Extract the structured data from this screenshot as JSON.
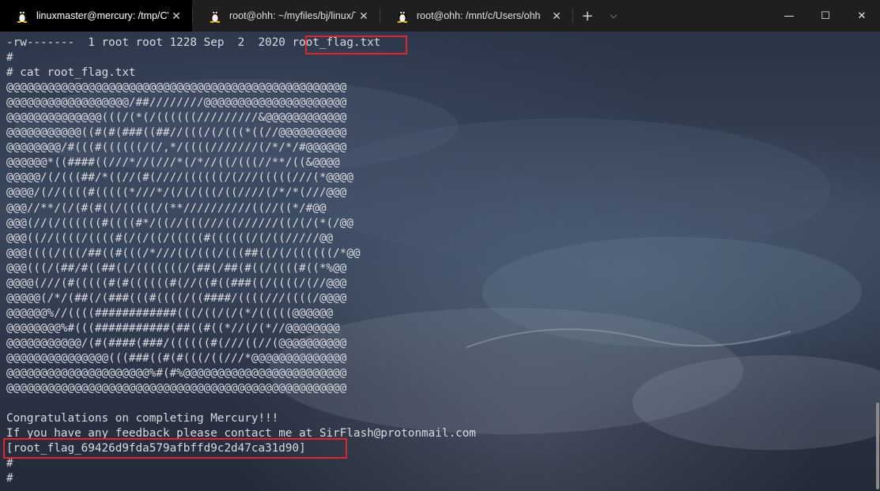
{
  "tabs": [
    {
      "label": "linuxmaster@mercury: /tmp/CV",
      "active": true,
      "icon": "tux-icon"
    },
    {
      "label": "root@ohh: ~/myfiles/bj/linux/Tl",
      "active": false,
      "icon": "tux-icon"
    },
    {
      "label": "root@ohh: /mnt/c/Users/ohh",
      "active": false,
      "icon": "tux-icon"
    }
  ],
  "tabbar": {
    "close_symbol": "✕",
    "new_tab_symbol": "+",
    "dropdown_symbol": "⌵",
    "minimize_symbol": "—",
    "maximize_symbol": "☐",
    "window_close_symbol": "✕"
  },
  "terminal": {
    "lines": [
      "-rw-------  1 root root 1228 Sep  2  2020 root_flag.txt",
      "#",
      "# cat root_flag.txt",
      "@@@@@@@@@@@@@@@@@@@@@@@@@@@@@@@@@@@@@@@@@@@@@@@@@@",
      "@@@@@@@@@@@@@@@@@@/##////////@@@@@@@@@@@@@@@@@@@@@",
      "@@@@@@@@@@@@@@(((/(*(/((((((/////////&@@@@@@@@@@@@",
      "@@@@@@@@@@@((#(#(###((##//(((/(/(((*((//@@@@@@@@@@",
      "@@@@@@@@/#(((#((((((/(/,*/((((///////(/*/*/#@@@@@@",
      "@@@@@@*((####((///*//(///*(/*//((/(((//**/((&@@@@",
      "@@@@@/(/(((##/*((//(#(////((((((/(///(((((///(*@@@@",
      "@@@@/(//((((#(((((*///*/(/(/(((/((////(/*/*(///@@@",
      "@@@//**/(/(#(#((/(((((/(**//////////((//((*/#@@",
      "@@@(//(/((((((#((((#*/((//(((///((//////((/(/(*(/@@",
      "@@@((//((((/((((#(/(/((/(((((#((((((/(/((/////@@",
      "@@@((((/(((/##((#(((/*///((/(((/(((##((/(/((((((/*@@",
      "@@@(((/(##/#((##((/(((((((/(##(/##(#((/((((#((*%@@",
      "@@@@(///(#(((((#(#((((((#(//((#((###((/((((/(//@@@",
      "@@@@@(/*/(##(/(###(((#((((/((####/((((///((((/@@@@",
      "@@@@@@%//((((############(((/((/(/(*/(((((@@@@@@",
      "@@@@@@@@%#(((###########(##((#((*//(/(*//@@@@@@@@",
      "@@@@@@@@@@@/(#(####(###/((((((#(///((//(@@@@@@@@@@",
      "@@@@@@@@@@@@@@@(((###((#(#(((/((///*@@@@@@@@@@@@@@",
      "@@@@@@@@@@@@@@@@@@@@@%#(#%@@@@@@@@@@@@@@@@@@@@@@@@",
      "@@@@@@@@@@@@@@@@@@@@@@@@@@@@@@@@@@@@@@@@@@@@@@@@@@",
      "",
      "Congratulations on completing Mercury!!!",
      "If you have any feedback please contact me at SirFlash@protonmail.com",
      "[root_flag_69426d9fda579afbffd9c2d47ca31d90]",
      "#",
      "#"
    ]
  },
  "colors": {
    "highlight": "#e0262b",
    "terminal_text": "#d8dbe0",
    "tabbar_bg": "#1f1f1f"
  }
}
